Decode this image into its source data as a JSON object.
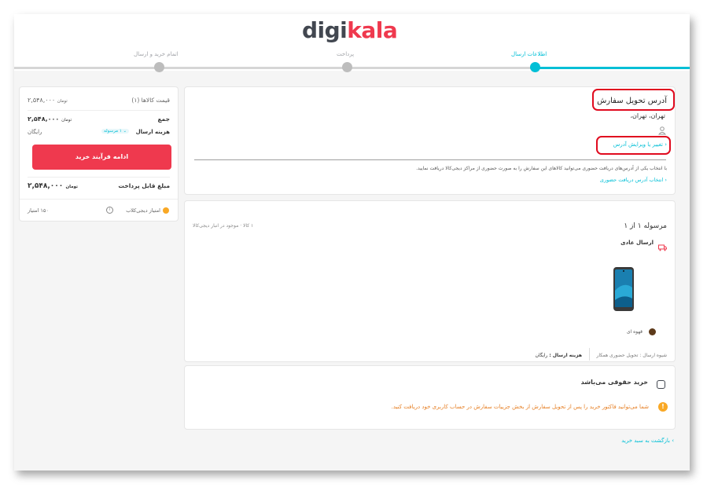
{
  "brand": {
    "logo_a": "digi",
    "logo_b": "kala"
  },
  "steps": [
    {
      "label": "اطلاعات ارسال",
      "state": "active"
    },
    {
      "label": "پرداخت",
      "state": "pending"
    },
    {
      "label": "اتمام خرید و ارسال",
      "state": "pending"
    }
  ],
  "address": {
    "heading": "آدرس تحویل سفارش",
    "city": "تهران، تهران،",
    "edit_link": "تغییر یا ویرایش آدرس",
    "note": "با انتخاب یکی از آدرس‌های دریافت حضوری می‌توانید کالاهای این سفارش را به صورت حضوری از مراکز دیجی‌کالا دریافت نمایید.",
    "pickup_link": "انتخاب آدرس دریافت حضوری"
  },
  "shipment": {
    "title": "مرسوله ۱ از ۱",
    "count": "۱ کالا",
    "availability": "موجود در انبار دیجی‌کالا",
    "method": "ارسال عادی",
    "color_name": "قهوه ای",
    "delivery_method": "شیوه ارسال : تحویل حضوری همکار",
    "cost_label": "هزینه ارسال :",
    "cost_value": "رایگان"
  },
  "legal": {
    "checkbox_label": "خرید حقوقی می‌باشد",
    "invoice_note": "شما می‌توانید فاکتور خرید را پس از تحویل سفارش از بخش جزییات سفارش در حساب کاربری خود دریافت کنید."
  },
  "back_link": "بازگشت به سبد خرید",
  "summary": {
    "items_label": "قیمت کالاها (۱)",
    "items_price": "۲,۵۴۸,۰۰۰",
    "items_unit": "تومان",
    "total_label": "جمع",
    "total_price": "۲,۵۴۸,۰۰۰",
    "total_unit": "تومان",
    "shipping_label": "هزینه ارسال",
    "shipping_badge": "۱ مرسوله",
    "shipping_value": "رایگان",
    "continue_button": "ادامه فرآیند خرید",
    "payable_label": "مبلغ قابل پرداخت",
    "payable_price": "۲,۵۴۸,۰۰۰",
    "payable_unit": "تومان",
    "club_label": "امتیاز دیجی‌کلاب",
    "club_points": "۱۵۰ امتیاز"
  },
  "colors": {
    "accent": "#00bfd6",
    "brand_red": "#ef394e",
    "warning": "#f9a825",
    "product_color": "#5d3a1a"
  }
}
